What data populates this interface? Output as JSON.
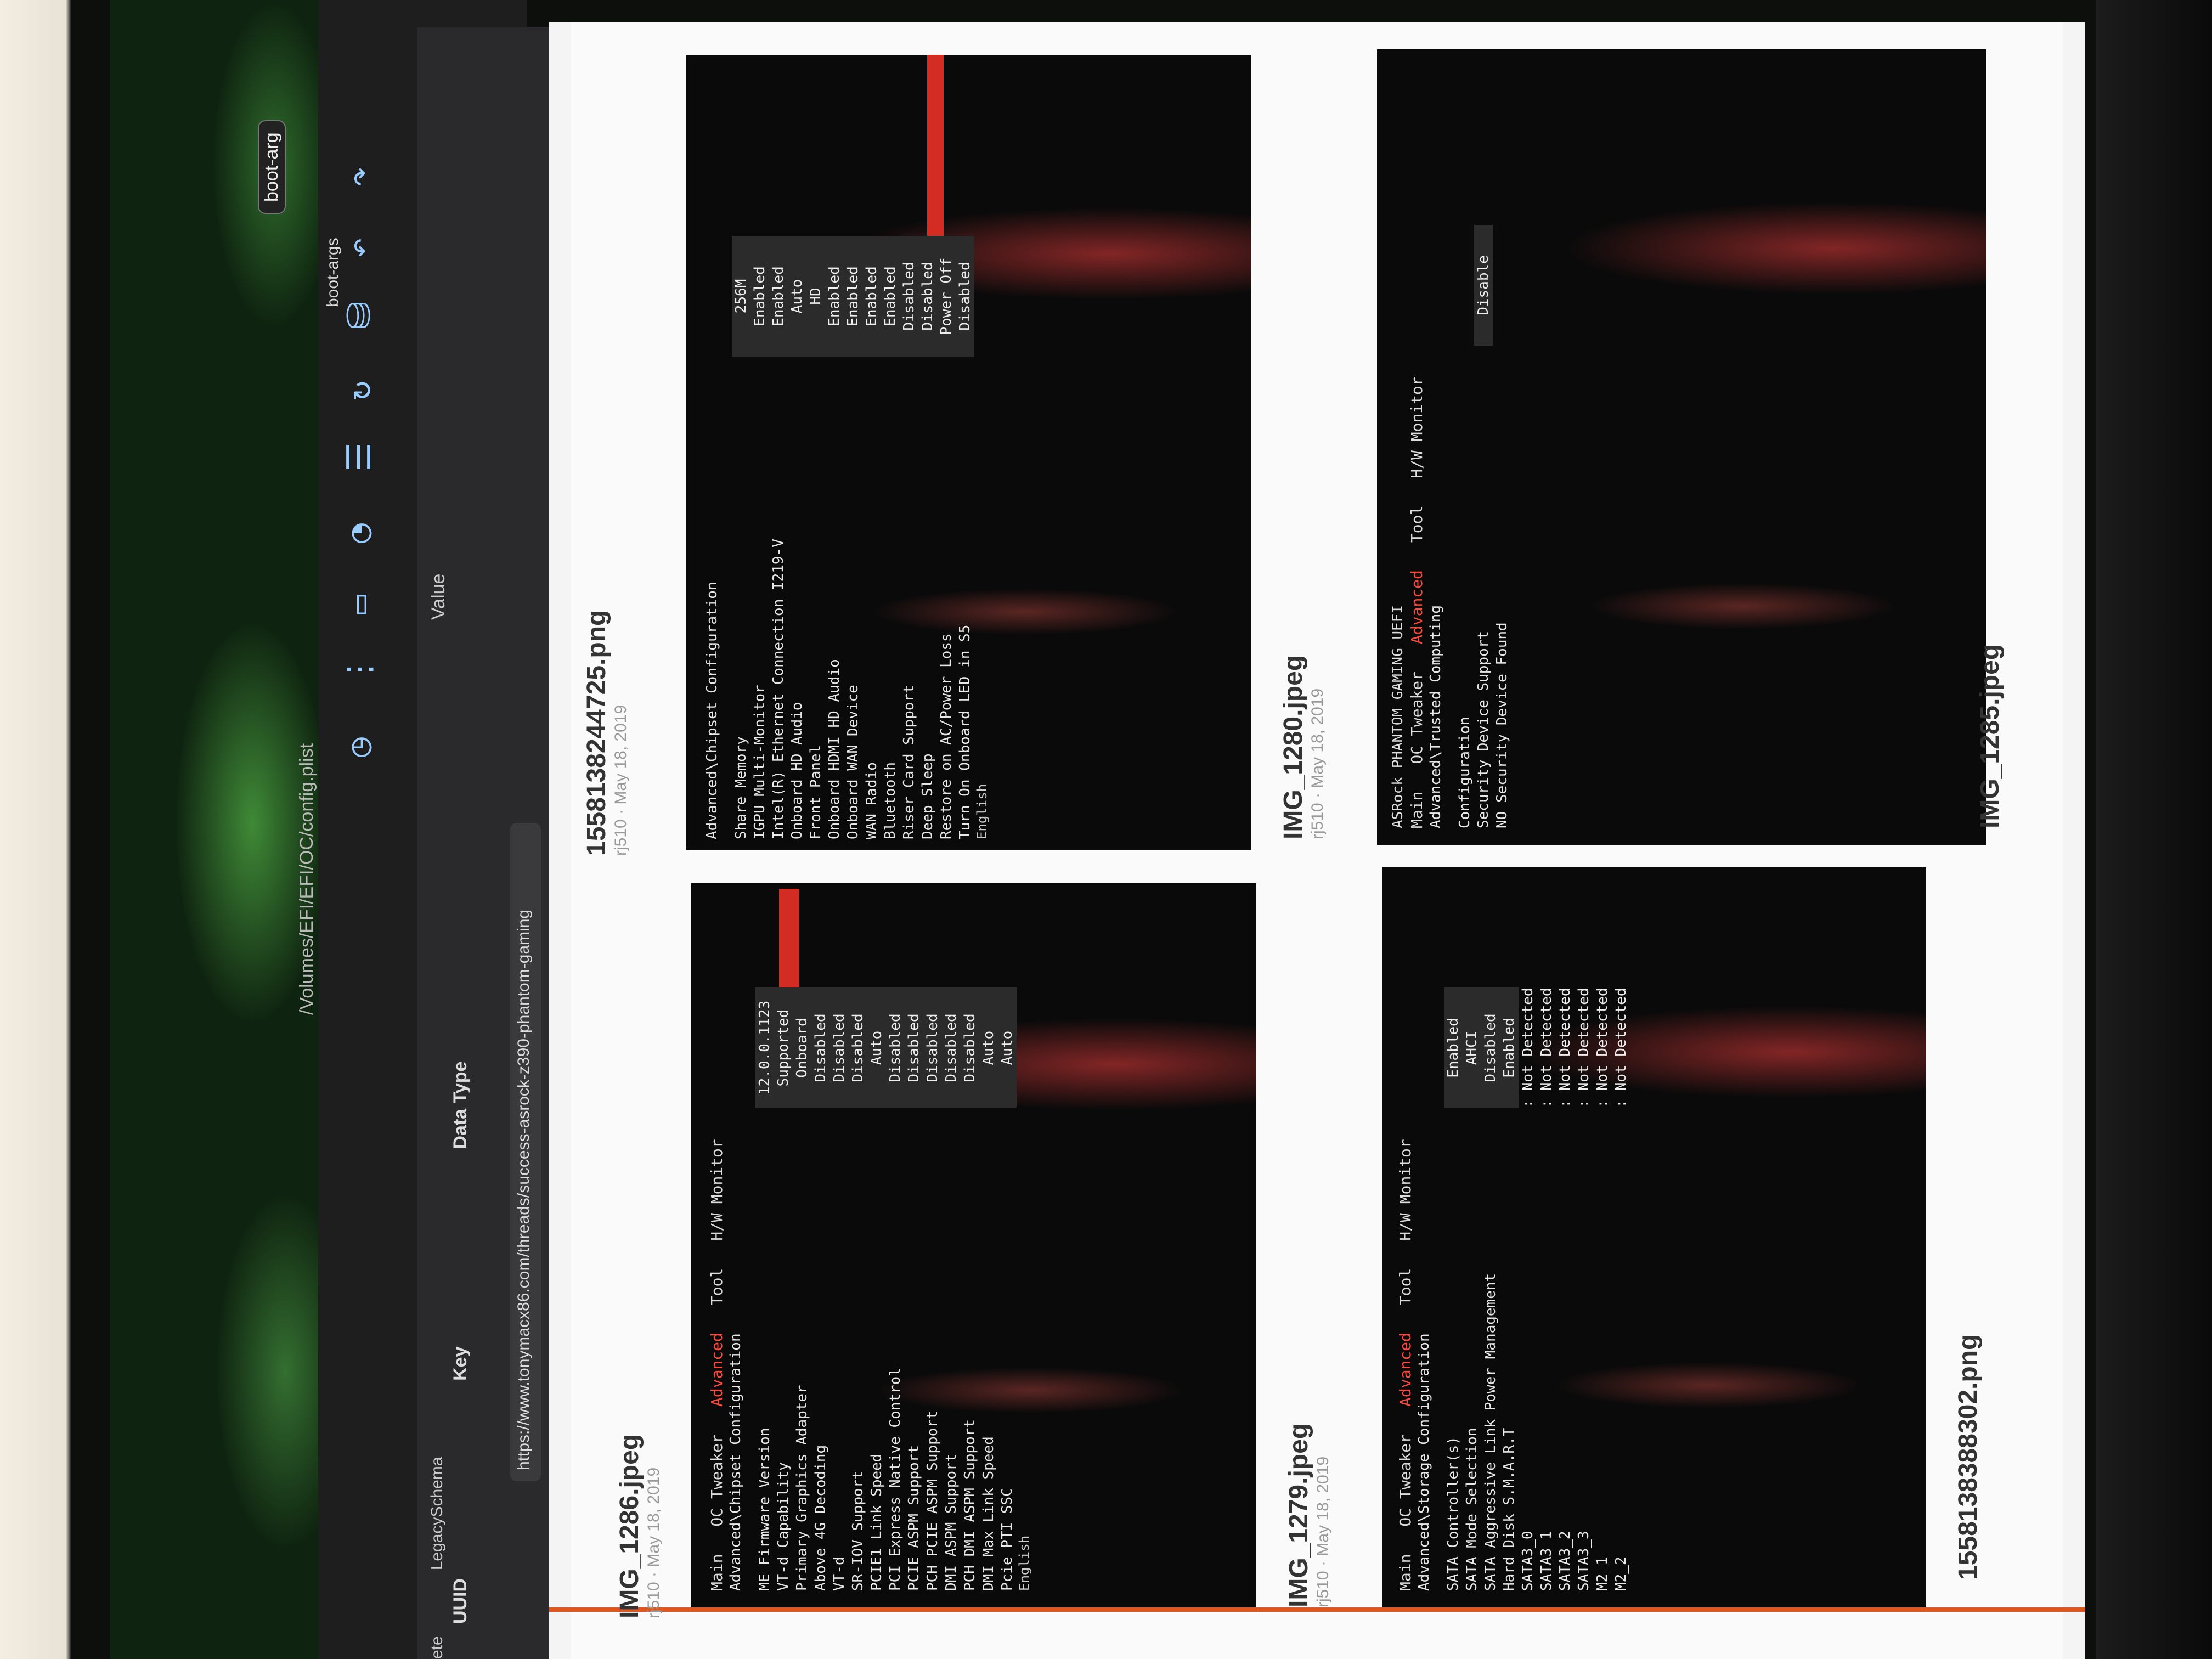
{
  "path_bar": "/Volumes/EFI/EFI/OC/config.plist",
  "toolbar_label": "Value",
  "bootarg_tag": "boot-arg",
  "bootargs_key": "boot-args",
  "columns": [
    "UUID",
    "Key",
    "Data Type"
  ],
  "left_labels": [
    "ete",
    "LegacySchema"
  ],
  "url": "https://www.tonymacx86.com/threads/success-asrock-z390-phantom-gaming",
  "cards": [
    {
      "title": "IMG_1286.jpeg",
      "meta": "rj510 · May 18, 2019",
      "tabs": [
        "Main",
        "OC Tweaker",
        "Advanced",
        "Tool",
        "H/W Monitor"
      ],
      "active": "Advanced",
      "path": "Advanced\\Chipset Configuration",
      "rows": [
        [
          "ME Firmware Version",
          "12.0.0.1123"
        ],
        [
          "VT-d Capability",
          "Supported"
        ],
        [
          "Primary Graphics Adapter",
          "Onboard"
        ],
        [
          "Above 4G Decoding",
          "Disabled"
        ],
        [
          "VT-d",
          "Disabled"
        ],
        [
          "SR-IOV Support",
          "Disabled"
        ],
        [
          "PCIE1 Link Speed",
          "Auto"
        ],
        [
          "PCI Express Native Control",
          "Disabled"
        ],
        [
          "PCIE ASPM Support",
          "Disabled"
        ],
        [
          "PCH PCIE ASPM Support",
          "Disabled"
        ],
        [
          "DMI ASPM Support",
          "Disabled"
        ],
        [
          "PCH DMI ASPM Support",
          "Disabled"
        ],
        [
          "DMI Max Link Speed",
          "Auto"
        ],
        [
          "Pcie PTI SSC",
          "Auto"
        ]
      ],
      "lang": "English"
    },
    {
      "title": "1558138244725.png",
      "meta": "rj510 · May 18, 2019",
      "path": "Advanced\\Chipset Configuration",
      "rows": [
        [
          "Share Memory",
          "256M"
        ],
        [
          "IGPU Multi-Monitor",
          "Enabled"
        ],
        [
          "Intel(R) Ethernet Connection I219-V",
          "Enabled"
        ],
        [
          "Onboard HD Audio",
          "Auto"
        ],
        [
          "Front Panel",
          "HD"
        ],
        [
          "Onboard HDMI HD Audio",
          "Enabled"
        ],
        [
          "Onboard WAN Device",
          "Enabled"
        ],
        [
          "WAN Radio",
          "Enabled"
        ],
        [
          "Bluetooth",
          "Enabled"
        ],
        [
          "Riser Card Support",
          "Disabled"
        ],
        [
          "Deep Sleep",
          "Disabled"
        ],
        [
          "Restore on AC/Power Loss",
          "Power Off"
        ],
        [
          "Turn On Onboard LED in S5",
          "Disabled"
        ]
      ],
      "lang": "English"
    },
    {
      "title": "IMG_1279.jpeg",
      "meta": "rj510 · May 18, 2019",
      "tabs": [
        "Main",
        "OC Tweaker",
        "Advanced",
        "Tool",
        "H/W Monitor"
      ],
      "active": "Advanced",
      "path": "Advanced\\Storage Configuration",
      "rows": [
        [
          "SATA Controller(s)",
          "Enabled"
        ],
        [
          "SATA Mode Selection",
          "AHCI"
        ],
        [
          "SATA Aggressive Link Power Management",
          "Disabled"
        ],
        [
          "Hard Disk S.M.A.R.T",
          "Enabled"
        ],
        [
          "SATA3_0",
          ": Not Detected"
        ],
        [
          "SATA3_1",
          ": Not Detected"
        ],
        [
          "SATA3_2",
          ": Not Detected"
        ],
        [
          "SATA3_3",
          ": Not Detected"
        ],
        [
          "M2_1",
          ": Not Detected"
        ],
        [
          "M2_2",
          ": Not Detected"
        ]
      ]
    },
    {
      "title": "IMG_1280.jpeg",
      "meta": "rj510 · May 18, 2019",
      "brand": "ASRock PHANTOM GAMING UEFI",
      "tabs": [
        "Main",
        "OC Tweaker",
        "Advanced",
        "Tool",
        "H/W Monitor"
      ],
      "active": "Advanced",
      "path": "Advanced\\Trusted Computing",
      "rows": [
        [
          "Configuration",
          ""
        ],
        [
          "Security Device Support",
          "Disable"
        ],
        [
          "NO Security Device Found",
          ""
        ]
      ]
    }
  ],
  "bottom_titles": [
    "1558138388302.png",
    "IMG_1285.jpeg"
  ]
}
